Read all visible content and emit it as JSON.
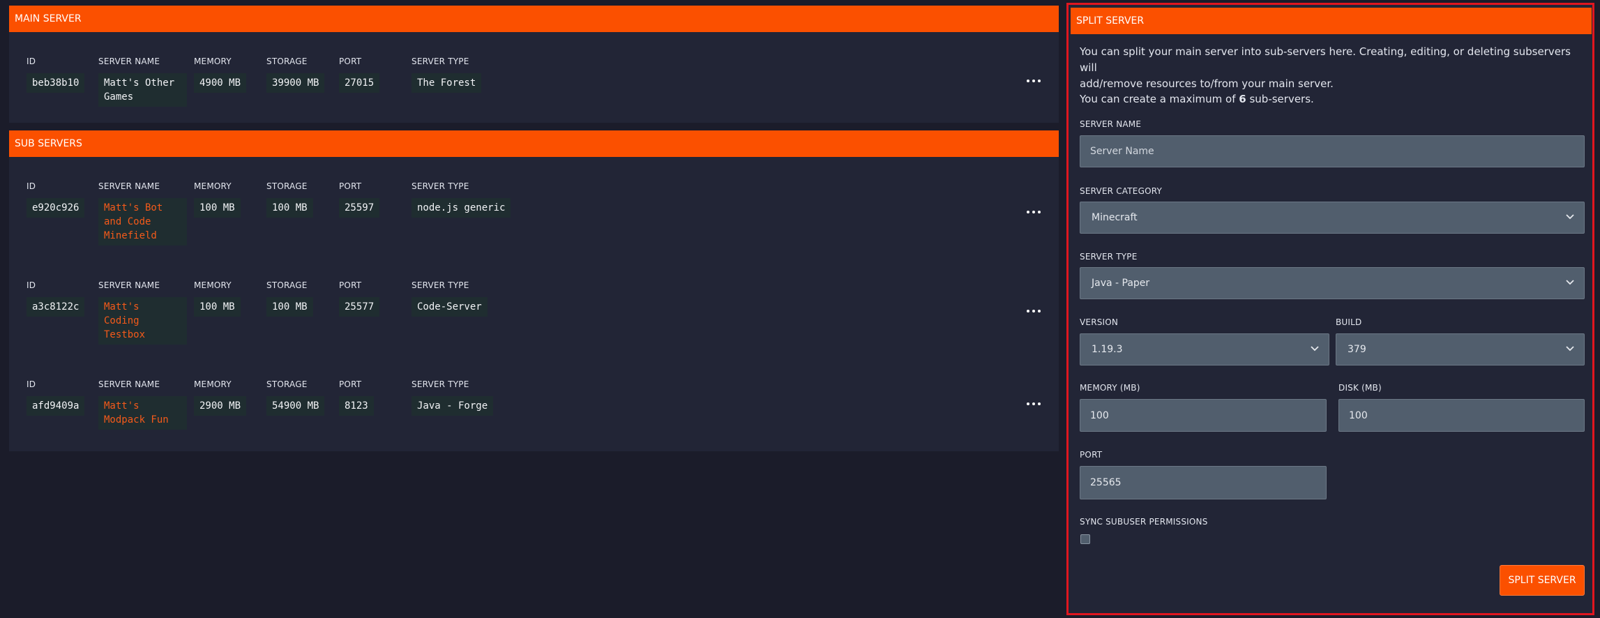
{
  "main_server": {
    "title": "MAIN SERVER",
    "columns": [
      "ID",
      "SERVER NAME",
      "MEMORY",
      "STORAGE",
      "PORT",
      "SERVER TYPE"
    ],
    "row": {
      "id": "beb38b10",
      "name_l1": "Matt's Other",
      "name_l2": "Games",
      "memory": "4900 MB",
      "storage": "39900 MB",
      "port": "27015",
      "type": "The Forest"
    }
  },
  "sub_servers": {
    "title": "SUB SERVERS",
    "columns": [
      "ID",
      "SERVER NAME",
      "MEMORY",
      "STORAGE",
      "PORT",
      "SERVER TYPE"
    ],
    "rows": [
      {
        "id": "e920c926",
        "name_l1": "Matt's Bot",
        "name_l2": "and Code",
        "name_l3": "Minefield",
        "memory": "100 MB",
        "storage": "100 MB",
        "port": "25597",
        "type": "node.js generic"
      },
      {
        "id": "a3c8122c",
        "name_l1": "Matt's",
        "name_l2": "Coding",
        "name_l3": "Testbox",
        "memory": "100 MB",
        "storage": "100 MB",
        "port": "25577",
        "type": "Code-Server"
      },
      {
        "id": "afd9409a",
        "name_l1": "Matt's",
        "name_l2": "Modpack Fun",
        "memory": "2900 MB",
        "storage": "54900 MB",
        "port": "8123",
        "type": "Java - Forge"
      }
    ]
  },
  "split_server": {
    "title": "SPLIT SERVER",
    "intro_l1": "You can split your main server into sub-servers here. Creating, editing, or deleting subservers will",
    "intro_l2": "add/remove resources to/from your main server.",
    "max_prefix": "You can create a maximum of ",
    "max_count": "6",
    "max_suffix": " sub-servers.",
    "server_name_label": "SERVER NAME",
    "server_name_placeholder": "Server Name",
    "category_label": "SERVER CATEGORY",
    "category_value": "Minecraft",
    "type_label": "SERVER TYPE",
    "type_value": "Java - Paper",
    "version_label": "VERSION",
    "version_value": "1.19.3",
    "build_label": "BUILD",
    "build_value": "379",
    "memory_label": "MEMORY (MB)",
    "memory_value": "100",
    "disk_label": "DISK (MB)",
    "disk_value": "100",
    "port_label": "PORT",
    "port_value": "25565",
    "sync_label": "SYNC SUBUSER PERMISSIONS",
    "sync_checked": false,
    "submit_label": "SPLIT SERVER"
  },
  "colors": {
    "accent": "#fb5000",
    "background": "#1b1c2a",
    "panel": "#222536",
    "link": "#f45a1a",
    "highlight_border": "#e0161f"
  },
  "icons": [
    "more-dots-icon",
    "chevron-down-icon"
  ]
}
